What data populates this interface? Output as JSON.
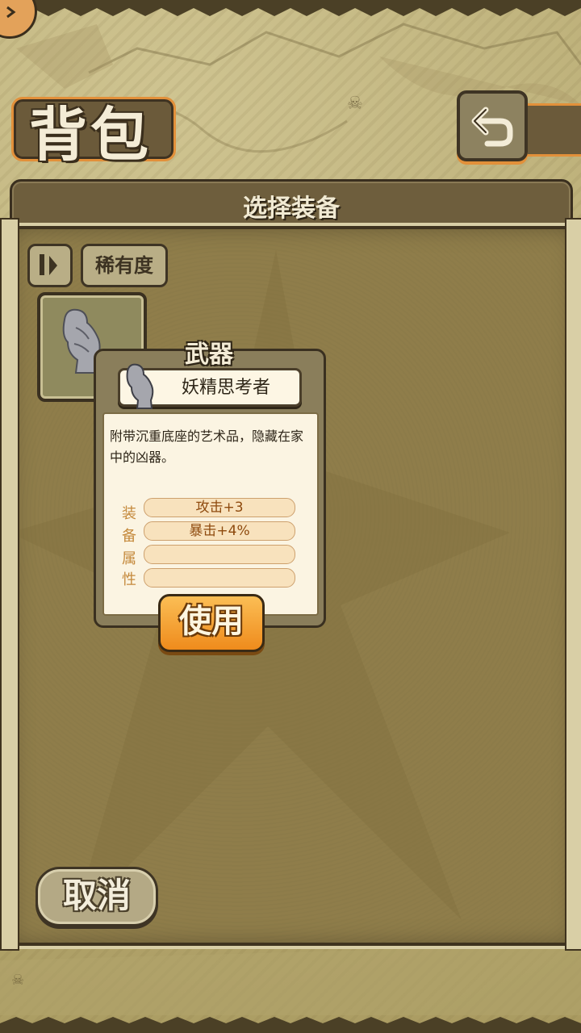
{
  "screen": {
    "title": "背包",
    "panel_title": "选择装备"
  },
  "toolbar": {
    "sort_icon": "sort-toggle-icon",
    "rarity_label": "稀有度",
    "back_icon": "back-arrow-icon"
  },
  "inventory": {
    "slots": [
      {
        "item_icon": "statue-icon",
        "selected": true
      }
    ]
  },
  "popup": {
    "category": "武器",
    "item_name": "妖精思考者",
    "description": "附带沉重底座的艺术品，隐藏在家中的凶器。",
    "attr_label_chars": [
      "装",
      "备",
      "属",
      "性"
    ],
    "attributes": [
      "攻击+3",
      "暴击+4%",
      "",
      ""
    ],
    "use_label": "使用"
  },
  "footer": {
    "cancel_label": "取消"
  },
  "colors": {
    "accent_orange": "#ef8b1c",
    "panel_brown": "#8f7d4a",
    "parchment": "#fbf4e2",
    "attr_text": "#8e4a0e"
  }
}
